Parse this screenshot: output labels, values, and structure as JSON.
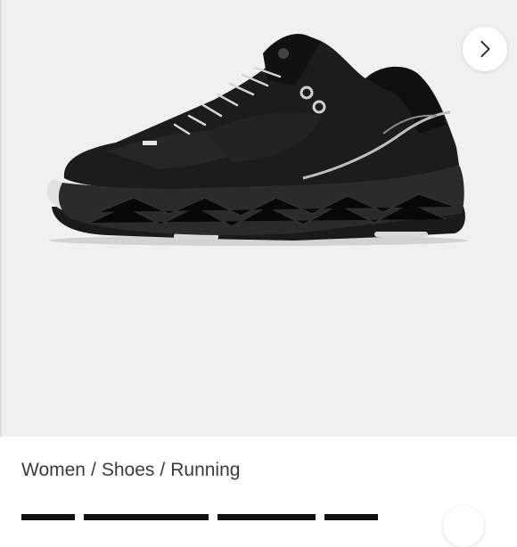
{
  "gallery": {
    "image_alt": "Black running shoe",
    "next_icon": "chevron-right-icon"
  },
  "breadcrumb": {
    "items": [
      "Women",
      "Shoes",
      "Running"
    ],
    "separator": "/"
  },
  "colors": {
    "gallery_bg": "#f0f0f0",
    "text": "#3a3a3a"
  }
}
